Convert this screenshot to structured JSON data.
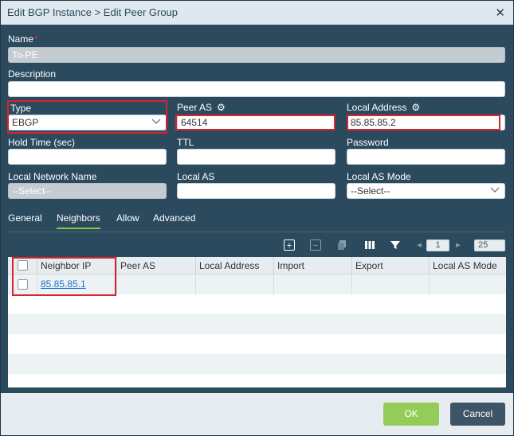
{
  "dialog": {
    "title": "Edit BGP Instance > Edit Peer Group",
    "close_glyph": "✕"
  },
  "form": {
    "name": {
      "label": "Name",
      "required_mark": "*",
      "value": "To-PE"
    },
    "description": {
      "label": "Description",
      "value": ""
    },
    "type": {
      "label": "Type",
      "value": "EBGP"
    },
    "peer_as": {
      "label": "Peer AS",
      "value": "64514",
      "icon": "gear-icon"
    },
    "local_address": {
      "label": "Local Address",
      "value": "85.85.85.2",
      "icon": "gear-icon"
    },
    "hold_time": {
      "label": "Hold Time (sec)",
      "value": ""
    },
    "ttl": {
      "label": "TTL",
      "value": ""
    },
    "password": {
      "label": "Password",
      "value": ""
    },
    "local_network_name": {
      "label": "Local Network Name",
      "value": "--Select--"
    },
    "local_as": {
      "label": "Local AS",
      "value": ""
    },
    "local_as_mode": {
      "label": "Local AS Mode",
      "value": "--Select--"
    }
  },
  "tabs": [
    {
      "label": "General",
      "active": false
    },
    {
      "label": "Neighbors",
      "active": true
    },
    {
      "label": "Allow",
      "active": false
    },
    {
      "label": "Advanced",
      "active": false
    }
  ],
  "toolbar": {
    "page": "1",
    "page_size": "25",
    "icons": [
      "add-icon",
      "remove-icon",
      "copy-icon",
      "columns-icon",
      "filter-icon",
      "prev-page-icon",
      "next-page-icon"
    ]
  },
  "table": {
    "columns": [
      "Neighbor IP",
      "Peer AS",
      "Local Address",
      "Import",
      "Export",
      "Local AS Mode"
    ],
    "rows": [
      {
        "neighbor_ip": "85.85.85.1"
      }
    ]
  },
  "footer": {
    "ok_label": "OK",
    "cancel_label": "Cancel"
  },
  "colors": {
    "panel": "#2b4a5e",
    "highlight": "#d9232e",
    "ok": "#94cc5a",
    "cancel": "#3f5566",
    "active_tab": "#8dc63f"
  }
}
